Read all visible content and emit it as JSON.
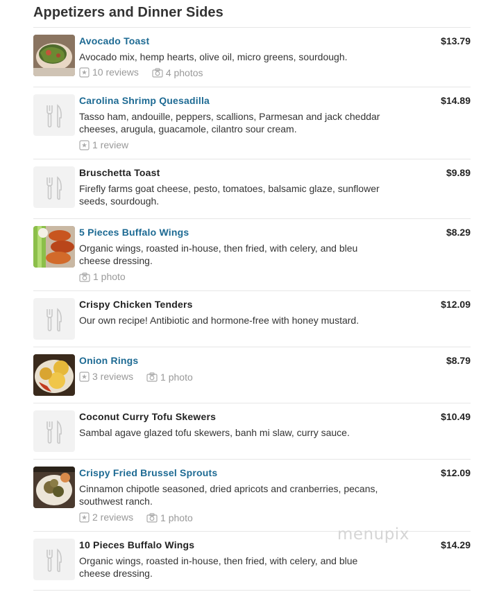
{
  "section": {
    "title": "Appetizers and Dinner Sides"
  },
  "items": [
    {
      "name": "Avocado Toast",
      "price": "$13.79",
      "desc": "Avocado mix, hemp hearts, olive oil, micro greens, sourdough.",
      "reviews": "10 reviews",
      "photos": "4 photos"
    },
    {
      "name": "Carolina Shrimp Quesadilla",
      "price": "$14.89",
      "desc": "Tasso ham, andouille, peppers, scallions, Parmesan and jack cheddar cheeses, arugula, guacamole, cilantro sour cream.",
      "reviews": "1 review"
    },
    {
      "name": "Bruschetta Toast",
      "price": "$9.89",
      "desc": "Firefly farms goat cheese, pesto, tomatoes, balsamic glaze, sunflower seeds, sourdough."
    },
    {
      "name": "5 Pieces Buffalo Wings",
      "price": "$8.29",
      "desc": "Organic wings, roasted in-house, then fried, with celery, and bleu cheese dressing.",
      "photos": "1 photo"
    },
    {
      "name": "Crispy Chicken Tenders",
      "price": "$12.09",
      "desc": "Our own recipe! Antibiotic and hormone-free with honey mustard."
    },
    {
      "name": "Onion Rings",
      "price": "$8.79",
      "reviews": "3 reviews",
      "photos": "1 photo"
    },
    {
      "name": "Coconut Curry Tofu Skewers",
      "price": "$10.49",
      "desc": "Sambal agave glazed tofu skewers, banh mi slaw, curry sauce."
    },
    {
      "name": "Crispy Fried Brussel Sprouts",
      "price": "$12.09",
      "desc": "Cinnamon chipotle seasoned, dried apricots and cranberries, pecans, southwest ranch.",
      "reviews": "2 reviews",
      "photos": "1 photo"
    },
    {
      "name": "10 Pieces Buffalo Wings",
      "price": "$14.29",
      "desc": "Organic wings, roasted in-house, then fried, with celery, and blue cheese dressing."
    }
  ],
  "watermark": "menupix"
}
